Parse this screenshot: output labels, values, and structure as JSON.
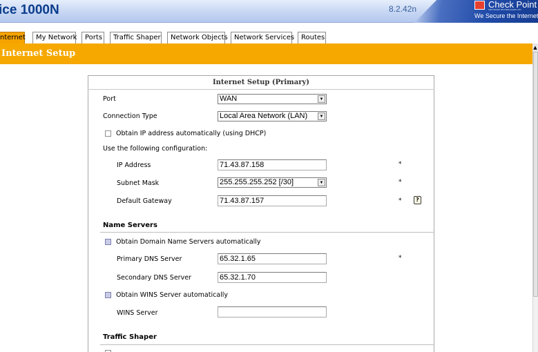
{
  "header": {
    "product": "ice 1000N",
    "version": "8.2.42n",
    "brand": "Check Point",
    "brand_sub": "SOFTWARE TECHNOLOGIES LTD",
    "brand_tagline": "We Secure the Internet"
  },
  "tabs": [
    "nternet",
    "My Network",
    "Ports",
    "Traffic Shaper",
    "Network Objects",
    "Network Services",
    "Routes"
  ],
  "banner_title": "Internet Setup",
  "panel_title": "Internet Setup (Primary)",
  "form": {
    "port_label": "Port",
    "port_value": "WAN",
    "connection_type_label": "Connection Type",
    "connection_type_value": "Local Area Network (LAN)",
    "dhcp_label": "Obtain IP address automatically (using DHCP)",
    "use_config_label": "Use the following configuration:",
    "ip_label": "IP Address",
    "ip_value": "71.43.87.158",
    "subnet_label": "Subnet Mask",
    "subnet_value": "255.255.255.252 [/30]",
    "gateway_label": "Default Gateway",
    "gateway_value": "71.43.87.157",
    "required_mark": "*",
    "help_glyph": "?"
  },
  "name_servers": {
    "title": "Name Servers",
    "auto_dns_label": "Obtain Domain Name Servers automatically",
    "primary_label": "Primary DNS Server",
    "primary_value": "65.32.1.65",
    "secondary_label": "Secondary DNS Server",
    "secondary_value": "65.32.1.70",
    "auto_wins_label": "Obtain WINS Server automatically",
    "wins_label": "WINS Server",
    "wins_value": ""
  },
  "traffic_shaper": {
    "title": "Traffic Shaper"
  },
  "colors": {
    "accent": "#f6a800",
    "header_blue": "#0b3d8c"
  }
}
